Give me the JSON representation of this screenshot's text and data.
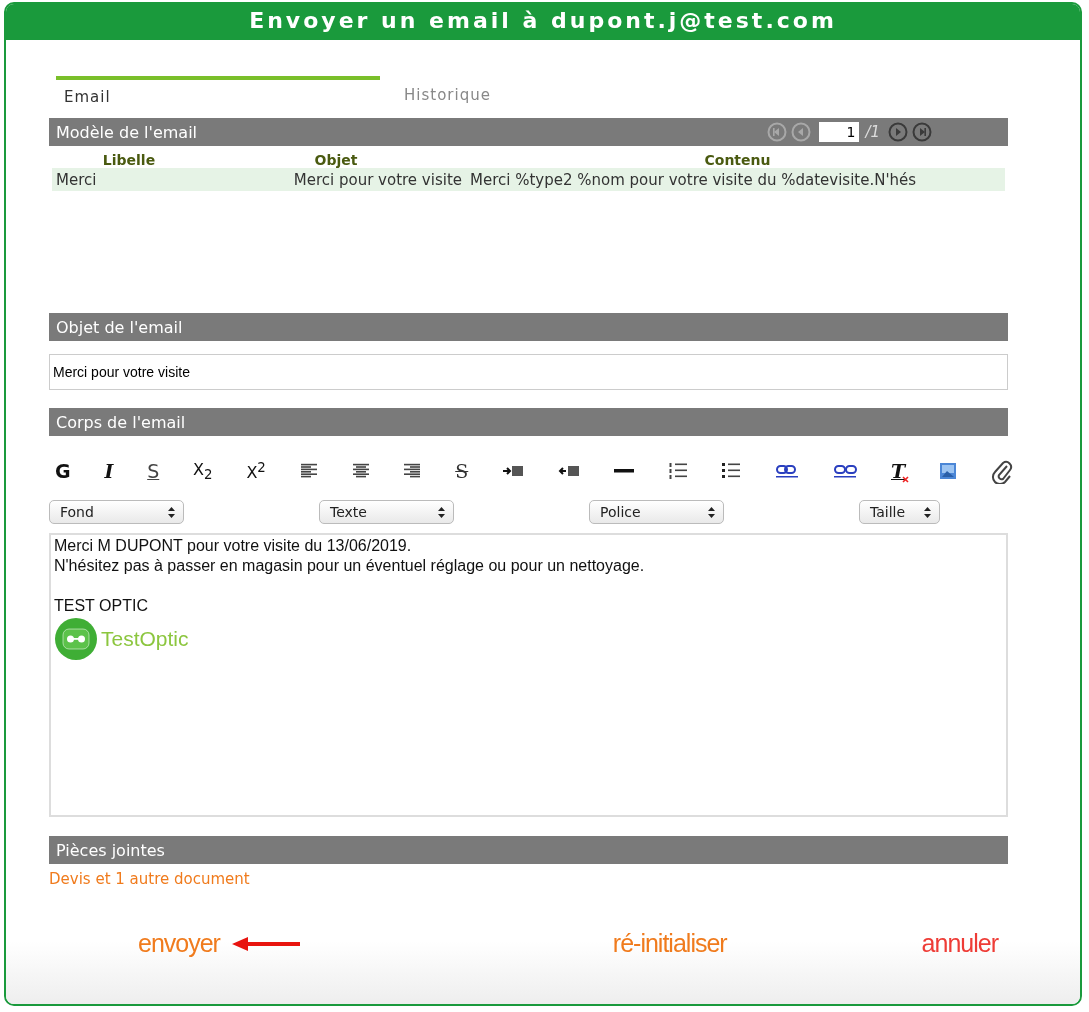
{
  "window": {
    "title": "Envoyer un email à dupont.j@test.com"
  },
  "tabs": [
    {
      "label": "Email",
      "selected": true
    },
    {
      "label": "Historique",
      "selected": false
    }
  ],
  "template_panel": {
    "title": "Modèle de l'email",
    "pager": {
      "first": {
        "disabled": true
      },
      "previous": {
        "disabled": true
      },
      "page": "1",
      "total": "/1",
      "next": {
        "disabled": false
      },
      "last": {
        "disabled": false
      }
    },
    "columns": [
      "Libelle",
      "Objet",
      "Contenu"
    ],
    "rows": [
      {
        "cells": [
          "Merci",
          "Merci pour votre visite",
          "Merci %type2 %nom pour votre visite du %datevisite.N'hés"
        ],
        "selected": true
      }
    ]
  },
  "subject_panel": {
    "title": "Objet de l'email",
    "value": "Merci pour votre visite"
  },
  "body_panel": {
    "title": "Corps de l'email",
    "toolbar": [
      {
        "kind": "bold",
        "label": "G"
      },
      {
        "kind": "italic",
        "label": "I"
      },
      {
        "kind": "underline",
        "label": "S"
      },
      {
        "kind": "subscript",
        "label": "X$_{2}$"
      },
      {
        "kind": "superscript",
        "label": "X$^{2}$"
      },
      {
        "kind": "align-left"
      },
      {
        "kind": "align-center"
      },
      {
        "kind": "align-right"
      },
      {
        "kind": "strike",
        "label": "S"
      },
      {
        "kind": "indent"
      },
      {
        "kind": "outdent"
      },
      {
        "kind": "rule"
      },
      {
        "kind": "ordered-list"
      },
      {
        "kind": "bullet-list"
      },
      {
        "kind": "link"
      },
      {
        "kind": "unlink"
      },
      {
        "kind": "clear-format",
        "label": "T"
      },
      {
        "kind": "image"
      },
      {
        "kind": "attach"
      }
    ],
    "selects": [
      "Fond",
      "Texte",
      "Police",
      "Taille"
    ],
    "lines": [
      "Merci M DUPONT pour votre visite du 13/06/2019.",
      "N'hésitez pas à passer en magasin pour un éventuel réglage ou pour un nettoyage."
    ],
    "signature": "TEST OPTIC",
    "logo_text": "TestOptic"
  },
  "attachments_panel": {
    "title": "Pièces jointes",
    "link": "Devis et 1 autre document"
  },
  "actions": [
    {
      "label": "envoyer",
      "color": "#f07b1d",
      "arrow": true
    },
    {
      "label": "ré-initialiser",
      "color": "#f07b1d",
      "arrow": false
    },
    {
      "label": "annuler",
      "color": "#ee3c36",
      "arrow": false
    }
  ]
}
